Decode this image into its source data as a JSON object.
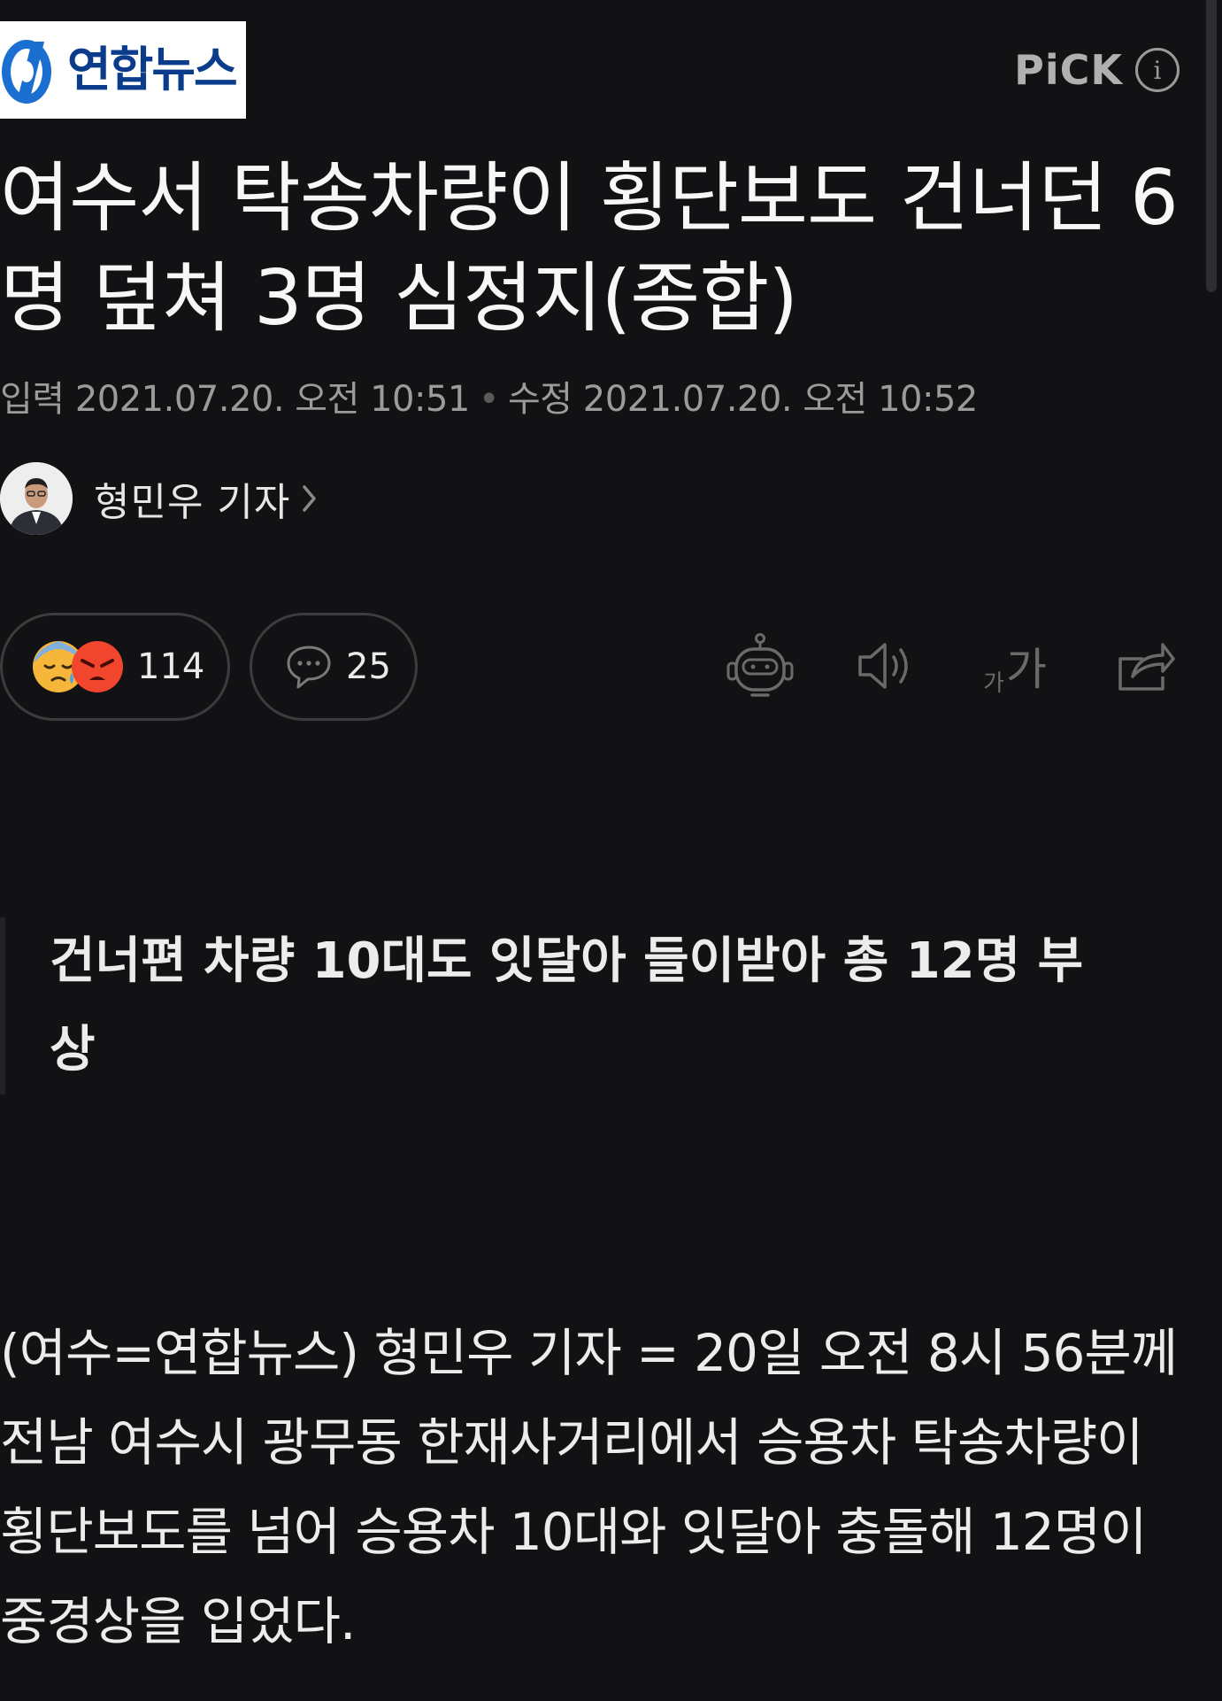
{
  "header": {
    "publisher_name": "연합뉴스",
    "pick_label": "PiCK",
    "info_symbol": "i",
    "icons": [
      "yonhap-logo",
      "info-icon"
    ]
  },
  "article": {
    "title": "여수서 탁송차량이 횡단보도 건너던 6명 덮쳐 3명 심정지(종합)",
    "input_label": "입력",
    "input_date": "2021.07.20. 오전 10:51",
    "separator": "•",
    "modified_label": "수정",
    "modified_date": "2021.07.20. 오전 10:52",
    "author": "형민우 기자",
    "subheading": "건너편 차량 10대도 잇달아 들이받아 총 12명 부상",
    "body": "(여수=연합뉴스) 형민우 기자 = 20일 오전 8시 56분께 전남 여수시 광무동 한재사거리에서 승용차 탁송차량이 횡단보도를 넘어 승용차 10대와 잇달아 충돌해 12명이 중경상을 입었다."
  },
  "actions": {
    "reaction_count": "114",
    "comment_count": "25",
    "font_size_small": "가",
    "font_size_large": "가",
    "icons": [
      "sad-emoji-icon",
      "angry-emoji-icon",
      "comment-icon",
      "robot-summary-icon",
      "speaker-icon",
      "font-size-icon",
      "share-icon"
    ]
  },
  "colors": {
    "background": "#121214",
    "text": "#f2f2f2",
    "muted": "#9b9b9b",
    "logo_blue": "#0b3c8c"
  }
}
